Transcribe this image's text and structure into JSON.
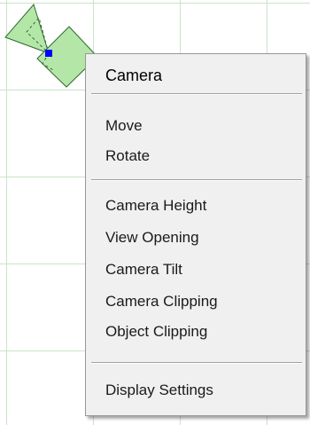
{
  "canvas": {
    "grid_color": "#c9e4c9",
    "background": "#ffffff"
  },
  "camera_symbol": {
    "icon": "camera-symbol-icon",
    "fill_color": "#b4e6a8",
    "outline_color": "#2e6b2e",
    "handle_color": "#0000ff"
  },
  "context_menu": {
    "title": "Camera",
    "items": [
      {
        "label": "Move"
      },
      {
        "label": "Rotate"
      },
      {
        "label": "Camera Height"
      },
      {
        "label": "View Opening"
      },
      {
        "label": "Camera Tilt"
      },
      {
        "label": "Camera Clipping"
      },
      {
        "label": "Object Clipping"
      },
      {
        "label": "Display Settings"
      }
    ]
  }
}
